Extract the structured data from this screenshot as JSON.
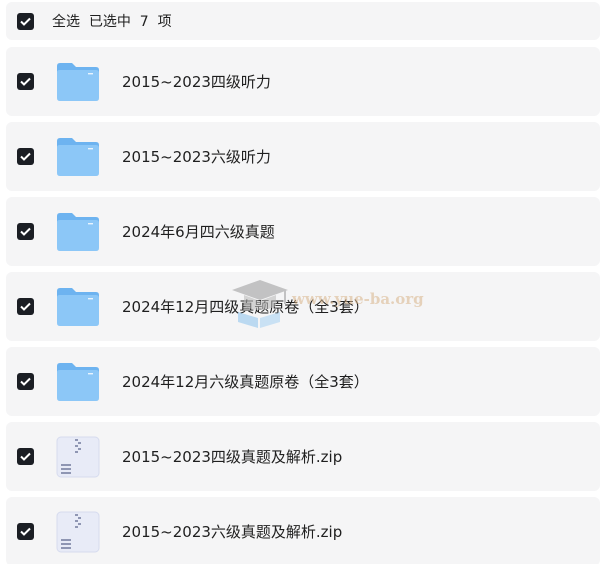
{
  "select_all": {
    "label": "全选  已选中  7  项",
    "checked": true
  },
  "items": [
    {
      "name": "2015~2023四级听力",
      "type": "folder",
      "checked": true
    },
    {
      "name": "2015~2023六级听力",
      "type": "folder",
      "checked": true
    },
    {
      "name": "2024年6月四六级真题",
      "type": "folder",
      "checked": true
    },
    {
      "name": "2024年12月四级真题原卷（全3套）",
      "type": "folder",
      "checked": true
    },
    {
      "name": "2024年12月六级真题原卷（全3套）",
      "type": "folder",
      "checked": true
    },
    {
      "name": "2015~2023四级真题及解析.zip",
      "type": "zip",
      "checked": true
    },
    {
      "name": "2015~2023六级真题及解析.zip",
      "type": "zip",
      "checked": true
    }
  ],
  "watermark": {
    "text": "www.yue-ba.org"
  },
  "colors": {
    "row_background": "#f5f5f6",
    "checkbox": "#1b1e24",
    "folder_main": "#8cc7f7",
    "folder_tab": "#6db3f0",
    "zip_body": "#e8ebf7"
  }
}
